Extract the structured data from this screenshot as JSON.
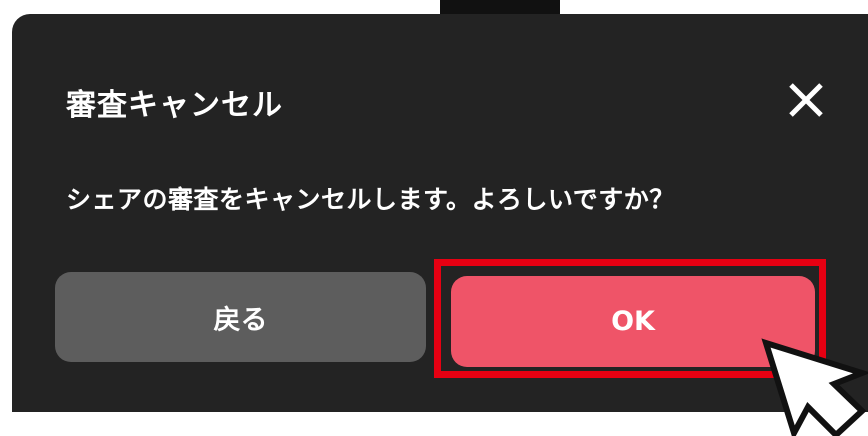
{
  "dialog": {
    "title": "審査キャンセル",
    "message": "シェアの審査をキャンセルします。よろしいですか？",
    "close_icon": "close-icon"
  },
  "buttons": {
    "back_label": "戻る",
    "ok_label": "OK"
  },
  "colors": {
    "dialog_background": "#232323",
    "back_button": "#5d5d5d",
    "ok_button": "#ef5468",
    "highlight_border": "#e60012"
  },
  "cursor_icon": "mouse-pointer-icon"
}
